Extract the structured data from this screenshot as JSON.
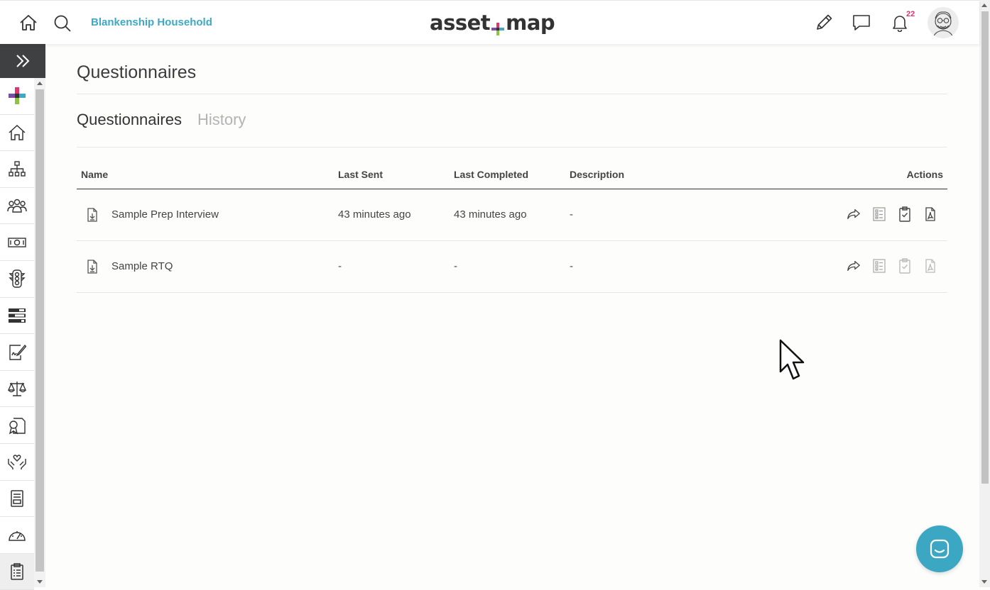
{
  "header": {
    "household_name": "Blankenship Household",
    "logo_left": "asset",
    "logo_right": "map",
    "notification_count": "22",
    "icons": [
      "home-icon",
      "search-icon",
      "pencil-icon",
      "chat-icon",
      "bell-icon",
      "avatar"
    ]
  },
  "sidebar": {
    "items": [
      "plus-logo-icon",
      "home-icon",
      "org-chart-icon",
      "members-icon",
      "cash-icon",
      "traffic-light-icon",
      "stacked-bars-icon",
      "signature-icon",
      "scales-icon",
      "certificate-icon",
      "heart-hands-icon",
      "document-icon",
      "speedometer-icon",
      "clipboard-icon"
    ],
    "active": "clipboard-icon"
  },
  "main": {
    "title": "Questionnaires",
    "tabs": [
      {
        "label": "Questionnaires",
        "active": true
      },
      {
        "label": "History",
        "active": false
      }
    ],
    "table": {
      "headers": {
        "name": "Name",
        "last_sent": "Last Sent",
        "last_completed": "Last Completed",
        "description": "Description",
        "actions": "Actions"
      },
      "rows": [
        {
          "name": "Sample Prep Interview",
          "last_sent": "43 minutes ago",
          "last_completed": "43 minutes ago",
          "description": "-",
          "actions_enabled": true
        },
        {
          "name": "Sample RTQ",
          "last_sent": "-",
          "last_completed": "-",
          "description": "-",
          "actions_enabled": false
        }
      ],
      "action_icons": [
        "share-icon",
        "list-icon",
        "clipboard-check-icon",
        "pdf-icon"
      ]
    }
  },
  "colors": {
    "accent": "#3ea9c4",
    "badge": "#e0356e",
    "sidebar_dark": "#3f4042",
    "chat_button": "#3ba7c2"
  }
}
